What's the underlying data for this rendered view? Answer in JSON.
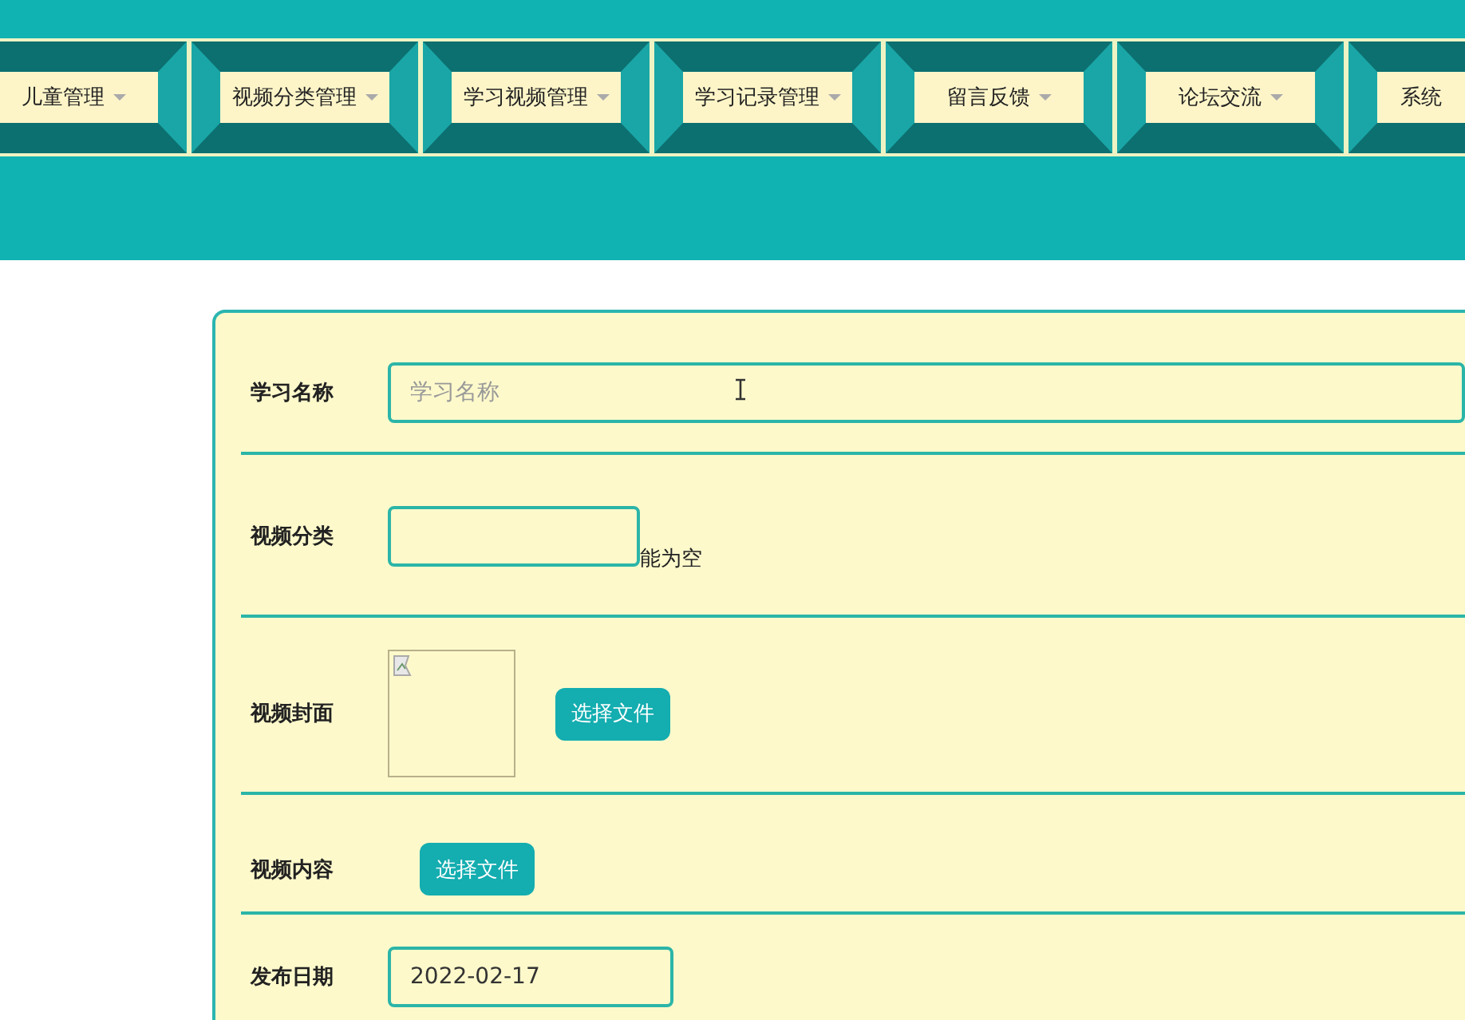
{
  "nav": {
    "items": [
      {
        "label": "儿童管理",
        "dropdown": true
      },
      {
        "label": "视频分类管理",
        "dropdown": true
      },
      {
        "label": "学习视频管理",
        "dropdown": true
      },
      {
        "label": "学习记录管理",
        "dropdown": true
      },
      {
        "label": "留言反馈",
        "dropdown": true
      },
      {
        "label": "论坛交流",
        "dropdown": true
      },
      {
        "label": "系统",
        "dropdown": false
      }
    ]
  },
  "form": {
    "fields": [
      {
        "kind": "text",
        "label": "学习名称",
        "placeholder": "学习名称"
      },
      {
        "kind": "short",
        "label": "视频分类",
        "hint": "能为空"
      },
      {
        "kind": "image",
        "label": "视频封面",
        "button": "选择文件"
      },
      {
        "kind": "file",
        "label": "视频内容",
        "button": "选择文件"
      },
      {
        "kind": "date",
        "label": "发布日期",
        "value": "2022-02-17"
      }
    ]
  }
}
